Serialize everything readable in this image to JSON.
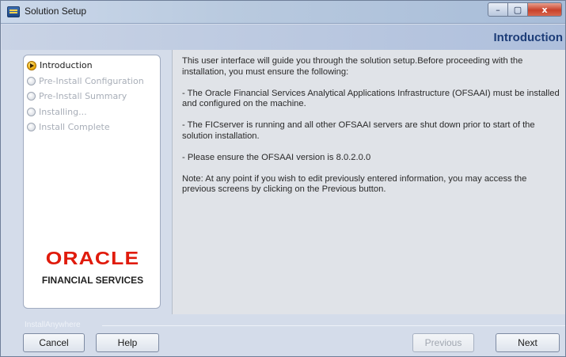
{
  "window": {
    "title": "Solution Setup",
    "controls": {
      "minimize": "–",
      "maximize": "▢",
      "close": "x"
    }
  },
  "header": {
    "title": "Introduction"
  },
  "steps": [
    {
      "label": "Introduction",
      "state": "current"
    },
    {
      "label": "Pre-Install Configuration",
      "state": "pending"
    },
    {
      "label": "Pre-Install Summary",
      "state": "pending"
    },
    {
      "label": "Installing...",
      "state": "pending"
    },
    {
      "label": "Install Complete",
      "state": "pending"
    }
  ],
  "branding": {
    "logo_text": "ORACLE",
    "subtitle": "FINANCIAL SERVICES"
  },
  "content": {
    "paragraphs": [
      "This user interface will guide you through the solution setup.Before proceeding with the installation, you must ensure the following:",
      "- The Oracle Financial Services Analytical Applications Infrastructure (OFSAAI) must be installed and configured on the machine.",
      "- The FICserver is running and all other OFSAAI servers are shut down prior to start of the solution installation.",
      "- Please ensure the OFSAAI version is 8.0.2.0.0",
      "Note: At any point if you wish to edit previously entered information, you may access the previous screens by clicking on the Previous button."
    ]
  },
  "footer": {
    "installer_label": "InstallAnywhere",
    "buttons": {
      "cancel": "Cancel",
      "help": "Help",
      "previous": "Previous",
      "next": "Next"
    }
  },
  "colors": {
    "header_title": "#1d3d78",
    "oracle_red": "#e01b0c",
    "window_bg": "#d4dcea",
    "content_bg": "#e0e3e8"
  },
  "icons": {
    "app": "installer-app-icon",
    "current_step": "arrow-right-circle-icon",
    "pending_step": "radio-circle-icon"
  }
}
